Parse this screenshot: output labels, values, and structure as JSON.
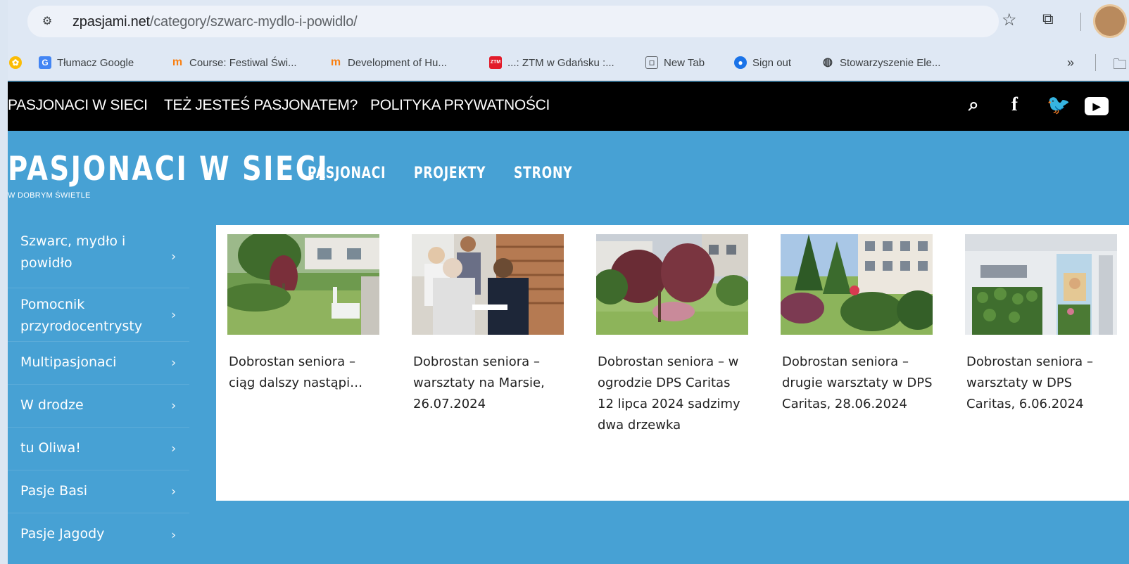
{
  "browser": {
    "url_domain": "zpasjami.net",
    "url_path": "/category/szwarc-mydlo-i-powidlo/",
    "bookmarks": [
      {
        "label": "Tłumacz Google",
        "icon": "translate-icon"
      },
      {
        "label": "Course: Festiwal Świ...",
        "icon": "moodle-icon"
      },
      {
        "label": "Development of Hu...",
        "icon": "moodle-icon"
      },
      {
        "label": "...: ZTM w Gdańsku :...",
        "icon": "ztm-icon"
      },
      {
        "label": "New Tab",
        "icon": "new-tab-icon"
      },
      {
        "label": "Sign out",
        "icon": "sign-out-icon"
      },
      {
        "label": "Stowarzyszenie Ele...",
        "icon": "globe-icon"
      }
    ],
    "more_label": "»"
  },
  "topnav": {
    "links": [
      "PASJONACI W SIECI",
      "TEŻ JESTEŚ PASJONATEM?",
      "POLITYKA PRYWATNOŚCI"
    ],
    "social": [
      "search-icon",
      "facebook-icon",
      "twitter-icon",
      "youtube-icon"
    ]
  },
  "header": {
    "title": "PASJONACI W SIECI",
    "tagline": "W DOBRYM ŚWIETLE",
    "nav": [
      "PASJONACI",
      "PROJEKTY",
      "STRONY"
    ]
  },
  "sidebar": {
    "items": [
      "Szwarc, mydło i powidło",
      "Pomocnik przyrodocentrysty",
      "Multipasjonaci",
      "W drodze",
      "tu Oliwa!",
      "Pasje Basi",
      "Pasje Jagody"
    ]
  },
  "posts": [
    {
      "title": "Dobrostan seniora – ciąg dalszy nastąpi…"
    },
    {
      "title": "Dobrostan seniora – warsztaty na Marsie, 26.07.2024"
    },
    {
      "title": "Dobrostan seniora – w ogrodzie DPS Caritas 12 lipca 2024 sadzimy dwa drzewka"
    },
    {
      "title": "Dobrostan seniora – drugie warsztaty w DPS Caritas, 28.06.2024"
    },
    {
      "title": "Dobrostan seniora – warsztaty w DPS Caritas, 6.06.2024"
    }
  ],
  "colors": {
    "site_bg": "#47a1d4",
    "topnav_bg": "#000000",
    "panel_bg": "#ffffff"
  }
}
